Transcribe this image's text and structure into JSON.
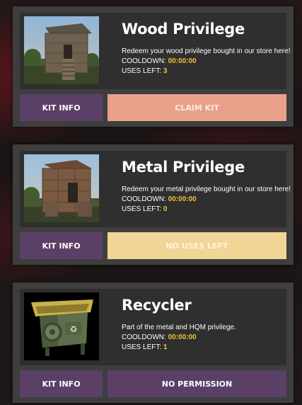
{
  "kits": [
    {
      "title": "Wood Privilege",
      "description": "Redeem your wood privilege bought in our store here!",
      "cooldown_label": "COOLDOWN: ",
      "cooldown_value": "00:00:00",
      "uses_label": "USES LEFT: ",
      "uses_value": "3",
      "kit_info_label": "KIT INFO",
      "action_label": "CLAIM KIT",
      "action_color": "#e8a08a"
    },
    {
      "title": "Metal Privilege",
      "description": "Redeem your metal privilege bought in our store here!",
      "cooldown_label": "COOLDOWN: ",
      "cooldown_value": "00:00:00",
      "uses_label": "USES LEFT: ",
      "uses_value": "0",
      "kit_info_label": "KIT INFO",
      "action_label": "NO USES LEFT",
      "action_color": "#f1d596"
    },
    {
      "title": "Recycler",
      "description": "Part of the metal and HQM privilege.",
      "cooldown_label": "COOLDOWN: ",
      "cooldown_value": "00:00:00",
      "uses_label": "USES LEFT: ",
      "uses_value": "1",
      "kit_info_label": "KIT INFO",
      "action_label": "NO PERMISSION",
      "action_color": "#5a3f66"
    }
  ],
  "colors": {
    "accent_value": "#f1c232",
    "kit_info_button": "#5a3f66",
    "card_bg": "#3e3e3e",
    "card_inner_bg": "#2f2f2f"
  },
  "icons": [
    "wood-house-image",
    "metal-house-image",
    "recycler-image"
  ]
}
